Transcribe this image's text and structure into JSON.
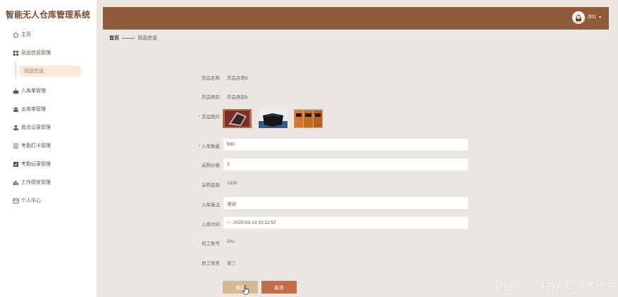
{
  "app": {
    "title": "智能无人仓库管理系统"
  },
  "sidebar": {
    "items": [
      {
        "label": "主页",
        "icon": "home-icon"
      },
      {
        "label": "货品信息管理",
        "icon": "grid-icon"
      },
      {
        "label": "入库单管理",
        "icon": "inbound-icon"
      },
      {
        "label": "出库单管理",
        "icon": "outbound-icon"
      },
      {
        "label": "盘点记录管理",
        "icon": "inventory-icon"
      },
      {
        "label": "考勤打卡管理",
        "icon": "list-icon"
      },
      {
        "label": "考勤记录管理",
        "icon": "record-icon"
      },
      {
        "label": "工作绩效管理",
        "icon": "chart-icon"
      },
      {
        "label": "个人中心",
        "icon": "profile-icon"
      }
    ],
    "submenu": {
      "active_label": "货品信息"
    }
  },
  "header": {
    "username": "001",
    "accent": "#8e5b3b"
  },
  "breadcrumb": {
    "home": "首页",
    "current": "货品信息"
  },
  "form": {
    "product_name": {
      "label": "货品名称",
      "value": "货品名称8"
    },
    "product_category": {
      "label": "货品类别",
      "value": "货品类别8"
    },
    "product_image": {
      "label": "货品图片",
      "required": "*"
    },
    "inbound_qty": {
      "label": "入库数量",
      "required": "*",
      "value": "500"
    },
    "purchase_price": {
      "label": "采购价格",
      "value": "3"
    },
    "purchase_amount": {
      "label": "采购金额",
      "value": "1500"
    },
    "inbound_note": {
      "label": "入库备注",
      "value": "测试"
    },
    "inbound_time": {
      "label": "入库时间",
      "value": "2025-03-13 10:12:57"
    },
    "employee_id": {
      "label": "员工账号",
      "value": "001"
    },
    "employee_name": {
      "label": "员工姓名",
      "value": "张三"
    }
  },
  "actions": {
    "confirm": "确定",
    "cancel": "取消"
  },
  "watermark": "CSDN @计算机毕设工作室"
}
